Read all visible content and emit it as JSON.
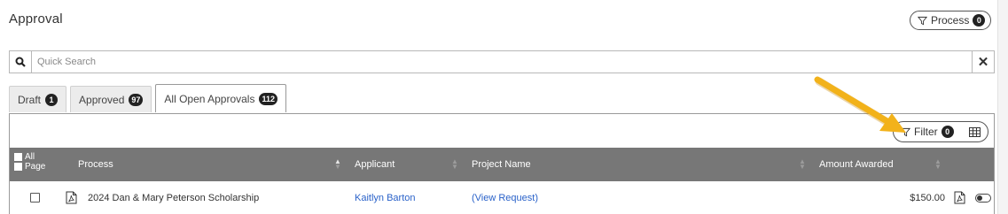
{
  "header": {
    "title": "Approval",
    "process_filter": {
      "label": "Process",
      "count": "0"
    }
  },
  "search": {
    "placeholder": "Quick Search",
    "value": ""
  },
  "tabs": [
    {
      "label": "Draft",
      "count": "1"
    },
    {
      "label": "Approved",
      "count": "97"
    },
    {
      "label": "All Open Approvals",
      "count": "112",
      "active": true
    }
  ],
  "toolbar": {
    "filter_label": "Filter",
    "filter_count": "0"
  },
  "table": {
    "select_all": {
      "all_label": "All",
      "page_label": "Page"
    },
    "columns": [
      "Process",
      "Applicant",
      "Project Name",
      "Amount Awarded"
    ],
    "rows": [
      {
        "process": "2024 Dan & Mary Peterson Scholarship",
        "applicant": "Kaitlyn Barton",
        "project": "(View Request)",
        "amount": "$150.00"
      }
    ]
  },
  "icons": {
    "search": "search-icon",
    "clear": "close-icon",
    "filter": "funnel-icon",
    "columns": "grid-icon",
    "pdf": "pdf-icon",
    "toggle": "toggle-icon"
  },
  "colors": {
    "header_bg": "#777777",
    "link": "#2a62c9",
    "badge": "#222222",
    "annotation_arrow": "#f2b21a"
  }
}
